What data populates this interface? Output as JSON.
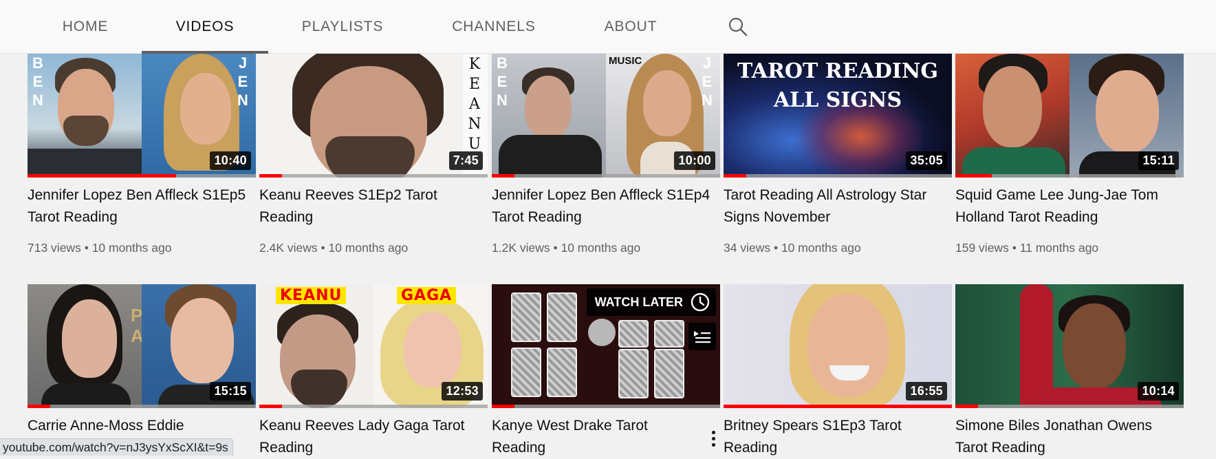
{
  "tabs": [
    {
      "label": "HOME"
    },
    {
      "label": "VIDEOS"
    },
    {
      "label": "PLAYLISTS"
    },
    {
      "label": "CHANNELS"
    },
    {
      "label": "ABOUT"
    }
  ],
  "videos": [
    {
      "title": "Jennifer Lopez Ben Affleck S1Ep5 Tarot Reading",
      "views": "713 views",
      "age": "10 months ago",
      "duration": "10:40",
      "progress": 0.65
    },
    {
      "title": "Keanu Reeves S1Ep2 Tarot Reading",
      "views": "2.4K views",
      "age": "10 months ago",
      "duration": "7:45",
      "progress": 0.1
    },
    {
      "title": "Jennifer Lopez Ben Affleck S1Ep4 Tarot Reading",
      "views": "1.2K views",
      "age": "10 months ago",
      "duration": "10:00",
      "progress": 0.1
    },
    {
      "title": "Tarot Reading All Astrology Star Signs November",
      "views": "34 views",
      "age": "10 months ago",
      "duration": "35:05",
      "progress": 0.1
    },
    {
      "title": "Squid Game Lee Jung-Jae Tom Holland Tarot Reading",
      "views": "159 views",
      "age": "11 months ago",
      "duration": "15:11",
      "progress": 0.16
    },
    {
      "title": "Carrie Anne-Moss Eddie",
      "duration": "15:15",
      "progress": 0.1
    },
    {
      "title": "Keanu Reeves Lady Gaga Tarot Reading",
      "duration": "12:53",
      "progress": 0.1
    },
    {
      "title": "Kanye West Drake Tarot Reading",
      "duration": "",
      "progress": 0.1
    },
    {
      "title": "Britney Spears S1Ep3 Tarot Reading",
      "duration": "16:55",
      "progress": 1.0
    },
    {
      "title": "Simone Biles Jonathan Owens Tarot Reading",
      "duration": "10:14",
      "progress": 0.1
    }
  ],
  "thumb_text": {
    "ben_letters": [
      "B",
      "E",
      "N"
    ],
    "jen_letters": [
      "J",
      "E",
      "N"
    ],
    "keanu_letters": [
      "K",
      "E",
      "A",
      "N",
      "U"
    ],
    "tarot_line1": "TAROT READING",
    "tarot_line2": "ALL SIGNS",
    "billboard": "MUSIC",
    "banner_keanu": "KEANU",
    "banner_gaga": "GAGA"
  },
  "watch_later_label": "WATCH LATER",
  "status_url": "youtube.com/watch?v=nJ3ysYxScXI&t=9s",
  "colors": {
    "accent": "#ff0000",
    "tab_indicator": "#606060"
  },
  "icons": {
    "search": "search-icon",
    "clock": "clock-icon",
    "queue": "add-to-queue-icon",
    "more": "more-vert-icon"
  }
}
